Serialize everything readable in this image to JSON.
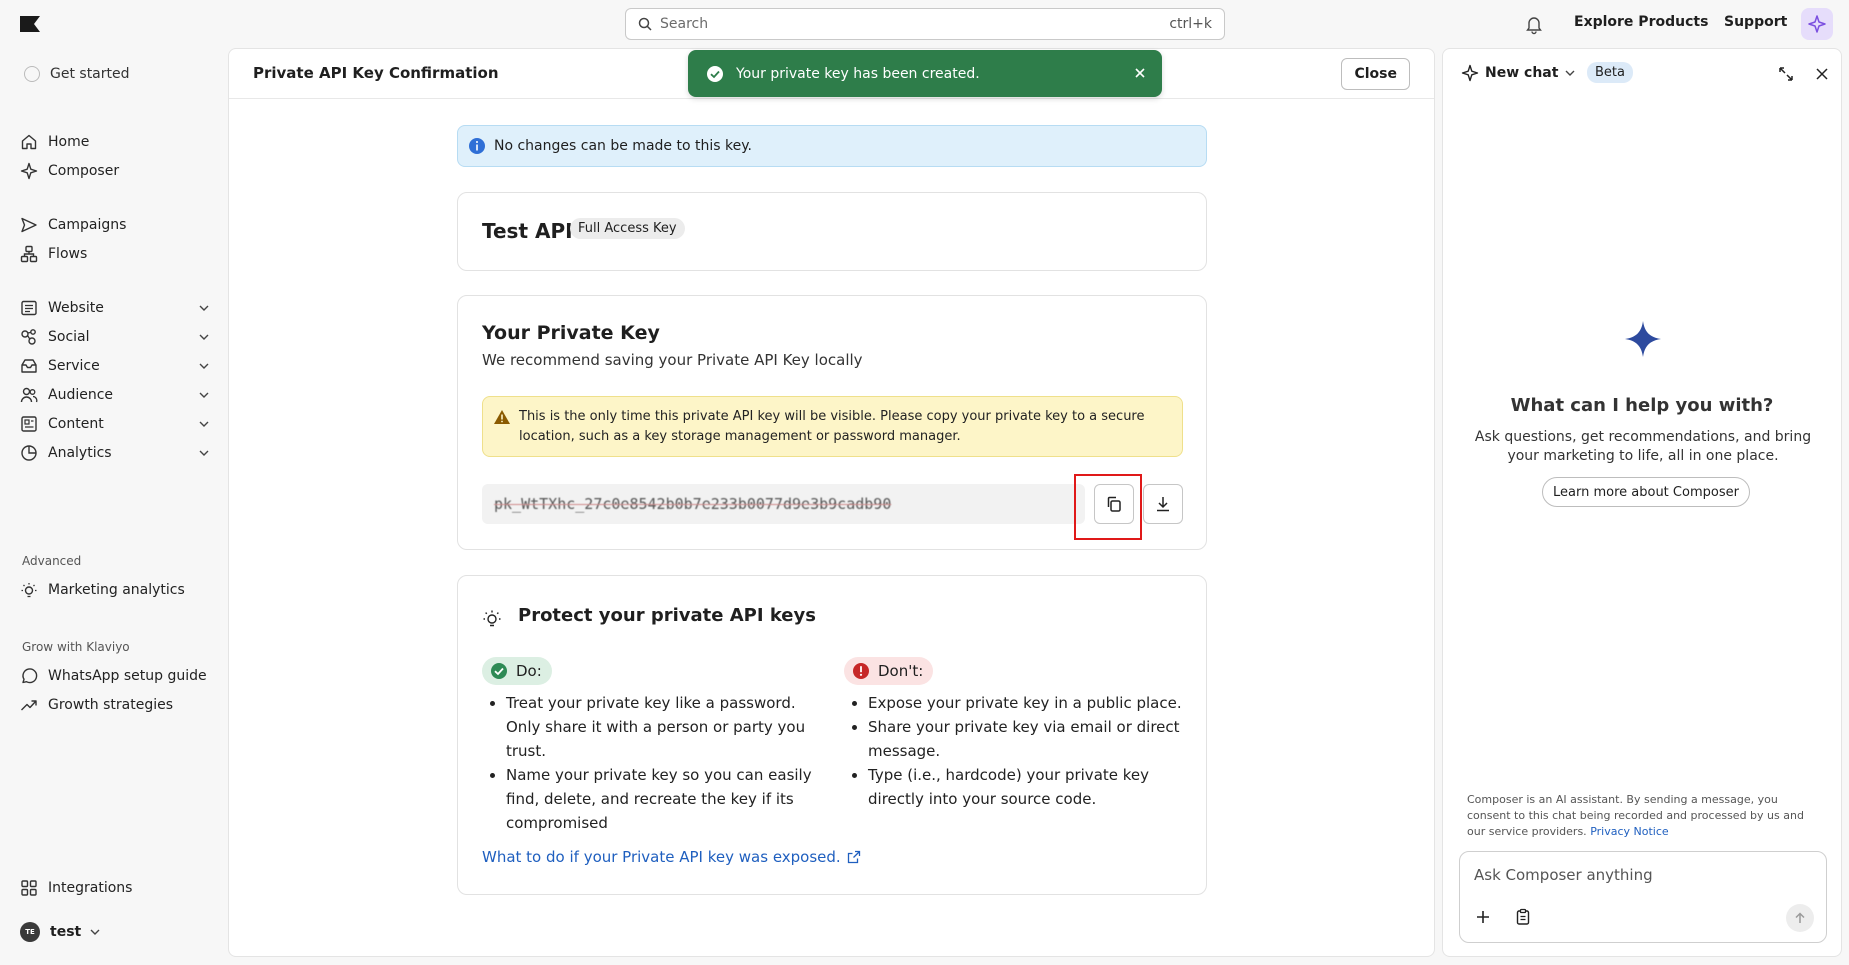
{
  "topbar": {
    "logo_icon": "klaviyo-flag-icon",
    "search_placeholder": "Search",
    "search_shortcut": "ctrl+k",
    "explore_label": "Explore Products",
    "support_label": "Support"
  },
  "sidebar": {
    "get_started": "Get started",
    "items": [
      {
        "label": "Home",
        "icon": "home-icon"
      },
      {
        "label": "Composer",
        "icon": "sparkle-icon"
      },
      {
        "label": "Campaigns",
        "icon": "send-icon"
      },
      {
        "label": "Flows",
        "icon": "flows-icon"
      },
      {
        "label": "Website",
        "icon": "website-icon"
      },
      {
        "label": "Social",
        "icon": "social-icon"
      },
      {
        "label": "Service",
        "icon": "service-icon"
      },
      {
        "label": "Audience",
        "icon": "audience-icon"
      },
      {
        "label": "Content",
        "icon": "content-icon"
      },
      {
        "label": "Analytics",
        "icon": "analytics-icon"
      }
    ],
    "advanced_label": "Advanced",
    "marketing_analytics": "Marketing analytics",
    "grow_label": "Grow with Klaviyo",
    "whatsapp": "WhatsApp setup guide",
    "growth": "Growth strategies",
    "integrations": "Integrations",
    "account_initials": "TE",
    "account_name": "test"
  },
  "main": {
    "title": "Private API Key Confirmation",
    "close_label": "Close",
    "toast": "Your private key has been created.",
    "info": "No changes can be made to this key.",
    "key_name": "Test API",
    "key_scope": "Full Access Key",
    "private_key_title": "Your Private Key",
    "private_key_sub": "We recommend saving your Private API Key locally",
    "warning": "This is the only time this private API key will be visible. Please copy your private key to a secure location, such as a key storage management or password manager.",
    "key_value": "pk_WtTXhc_27c0e8542b0b7e233b0077d9e3b9cadb90",
    "protect_title": "Protect your private API keys",
    "do_label": "Do:",
    "dont_label": "Don't:",
    "do_items": [
      "Treat your private key like a password. Only share it with a person or party you trust.",
      "Name your private key so you can easily find, delete, and recreate the key if its compromised"
    ],
    "dont_items": [
      "Expose your private key in a public place.",
      "Share your private key via email or direct message.",
      "Type (i.e., hardcode) your private key directly into your source code."
    ],
    "exposed_link": "What to do if your Private API key was exposed."
  },
  "chat": {
    "new_chat": "New chat",
    "beta": "Beta",
    "help_title": "What can I help you with?",
    "help_sub": "Ask questions, get recommendations, and bring your marketing to life, all in one place.",
    "learn_more": "Learn more about Composer",
    "disclaimer": "Composer is an AI assistant. By sending a message, you consent to this chat being recorded and processed by us and our service providers.",
    "privacy": "Privacy Notice",
    "input_placeholder": "Ask Composer anything"
  },
  "colors": {
    "toast_bg": "#2e7d4a",
    "info_bg": "#dff0fb",
    "warning_bg": "#fdf5c8",
    "link": "#1f5fbf",
    "highlight": "#e01919",
    "spark_accent": "#7b4fe0"
  }
}
